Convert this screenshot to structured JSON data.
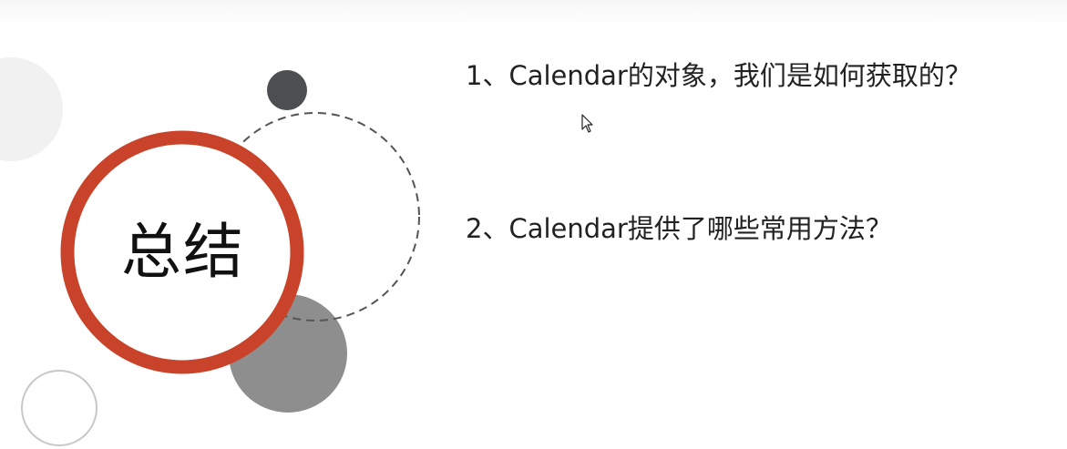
{
  "slide": {
    "title": "总结",
    "questions": [
      "1、Calendar的对象，我们是如何获取的？",
      "2、Calendar提供了哪些常用方法？"
    ]
  },
  "icons": {
    "cursor": "mouse-pointer-icon"
  },
  "colors": {
    "accent_ring": "#c9432a",
    "dark_dot": "#4b4f52",
    "gray_circle": "#8e8e8e",
    "light_circle": "#f1f1f1",
    "dashed_ring": "#555555",
    "outline_circle": "#c8c8c8"
  }
}
